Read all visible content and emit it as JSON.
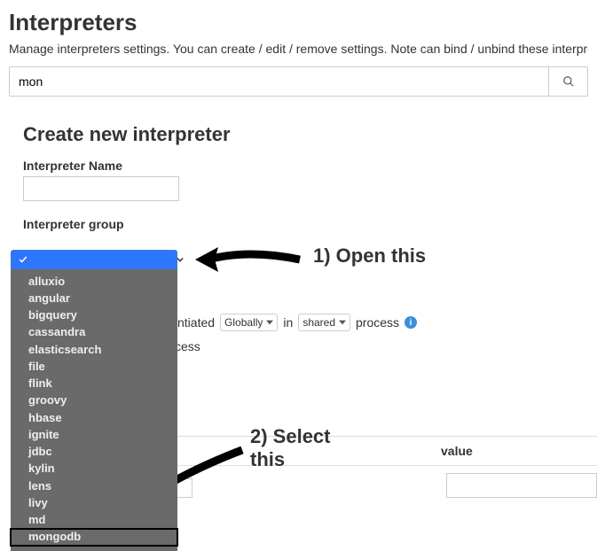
{
  "header": {
    "title": "Interpreters",
    "description": "Manage interpreters settings. You can create / edit / remove settings. Note can bind / unbind these interpre"
  },
  "search": {
    "value": "mon"
  },
  "create": {
    "heading": "Create new interpreter",
    "name_label": "Interpreter Name",
    "name_value": "",
    "group_label": "Interpreter group"
  },
  "dropdown": {
    "selected": "",
    "items": [
      "alluxio",
      "angular",
      "bigquery",
      "cassandra",
      "elasticsearch",
      "file",
      "flink",
      "groovy",
      "hbase",
      "ignite",
      "jdbc",
      "kylin",
      "lens",
      "livy",
      "md",
      "mongodb"
    ],
    "highlight_index": 15
  },
  "instantiation": {
    "prefix": "ntiated",
    "scope_value": "Globally",
    "mid": "in",
    "mode_value": "shared",
    "suffix": "process",
    "fragment": "cess"
  },
  "table": {
    "col_value": "value"
  },
  "annotations": {
    "open_this": "1) Open this",
    "select_this_line1": "2) Select",
    "select_this_line2": "this"
  }
}
